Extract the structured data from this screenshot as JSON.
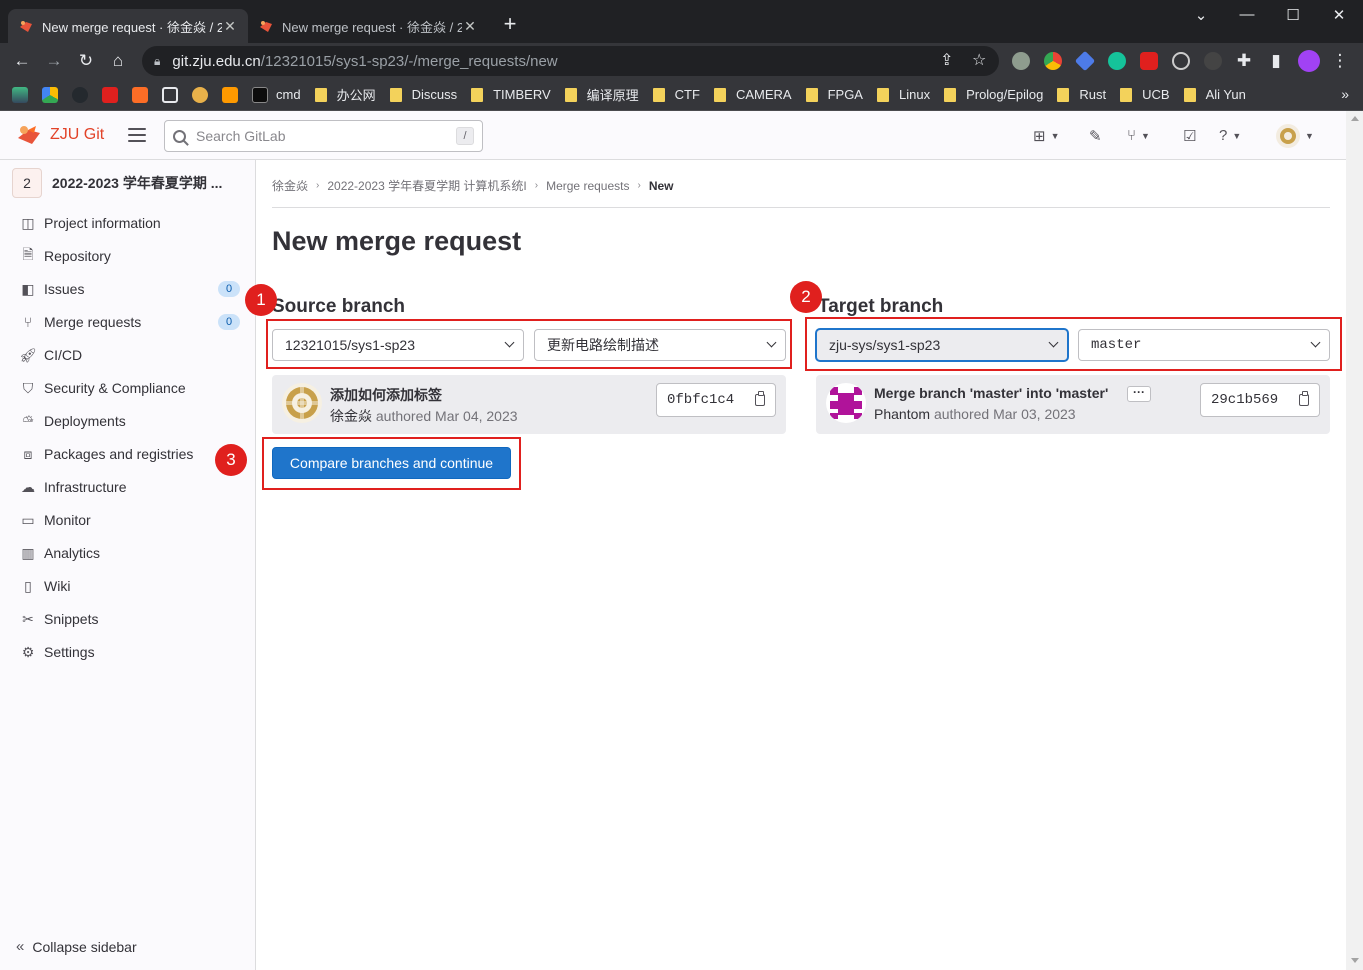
{
  "browser": {
    "tabs": [
      {
        "title": "New merge request · 徐金焱 / 2",
        "active": true
      },
      {
        "title": "New merge request · 徐金焱 / 2",
        "active": false
      }
    ],
    "url_host": "git.zju.edu.cn",
    "url_path": "/12321015/sys1-sp23/-/merge_requests/new",
    "bookmarks": [
      {
        "label": "cmd",
        "icon": "terminal-icon"
      },
      {
        "label": "办公网",
        "icon": "folder-icon"
      },
      {
        "label": "Discuss",
        "icon": "folder-icon"
      },
      {
        "label": "TIMBERV",
        "icon": "folder-icon"
      },
      {
        "label": "编译原理",
        "icon": "folder-icon"
      },
      {
        "label": "CTF",
        "icon": "folder-icon"
      },
      {
        "label": "CAMERA",
        "icon": "folder-icon"
      },
      {
        "label": "FPGA",
        "icon": "folder-icon"
      },
      {
        "label": "Linux",
        "icon": "folder-icon"
      },
      {
        "label": "Prolog/Epilog",
        "icon": "folder-icon"
      },
      {
        "label": "Rust",
        "icon": "folder-icon"
      },
      {
        "label": "UCB",
        "icon": "folder-icon"
      },
      {
        "label": "Ali Yun",
        "icon": "folder-icon"
      }
    ],
    "more_label": "»"
  },
  "header": {
    "brand": "ZJU Git",
    "search_placeholder": "Search GitLab",
    "search_shortcut": "/"
  },
  "sidebar": {
    "project_avatar": "2",
    "project_name": "2022-2023 学年春夏学期 ...",
    "items": [
      {
        "label": "Project information",
        "icon": "project-icon"
      },
      {
        "label": "Repository",
        "icon": "repository-icon"
      },
      {
        "label": "Issues",
        "icon": "issues-icon",
        "badge": "0"
      },
      {
        "label": "Merge requests",
        "icon": "merge-request-icon",
        "badge": "0"
      },
      {
        "label": "CI/CD",
        "icon": "rocket-icon"
      },
      {
        "label": "Security & Compliance",
        "icon": "shield-icon"
      },
      {
        "label": "Deployments",
        "icon": "deployments-icon"
      },
      {
        "label": "Packages and registries",
        "icon": "package-icon"
      },
      {
        "label": "Infrastructure",
        "icon": "cloud-icon"
      },
      {
        "label": "Monitor",
        "icon": "monitor-icon"
      },
      {
        "label": "Analytics",
        "icon": "chart-icon"
      },
      {
        "label": "Wiki",
        "icon": "book-icon"
      },
      {
        "label": "Snippets",
        "icon": "snippet-icon"
      },
      {
        "label": "Settings",
        "icon": "settings-icon"
      }
    ],
    "collapse_label": "Collapse sidebar"
  },
  "breadcrumb": [
    "徐金焱",
    "2022-2023 学年春夏学期 计算机系统I",
    "Merge requests",
    "New"
  ],
  "page_title": "New merge request",
  "source": {
    "title": "Source branch",
    "project": "12321015/sys1-sp23",
    "branch": "更新电路绘制描述",
    "commit_title": "添加如何添加标签",
    "commit_author": "徐金焱",
    "commit_meta": "authored Mar 04, 2023",
    "sha": "0fbfc1c4"
  },
  "target": {
    "title": "Target branch",
    "project": "zju-sys/sys1-sp23",
    "branch": "master",
    "commit_title": "Merge branch 'master' into 'master'",
    "commit_author": "Phantom",
    "commit_meta": "authored Mar 03, 2023",
    "sha": "29c1b569"
  },
  "compare_button": "Compare branches and continue",
  "annotations": [
    "1",
    "2",
    "3"
  ]
}
